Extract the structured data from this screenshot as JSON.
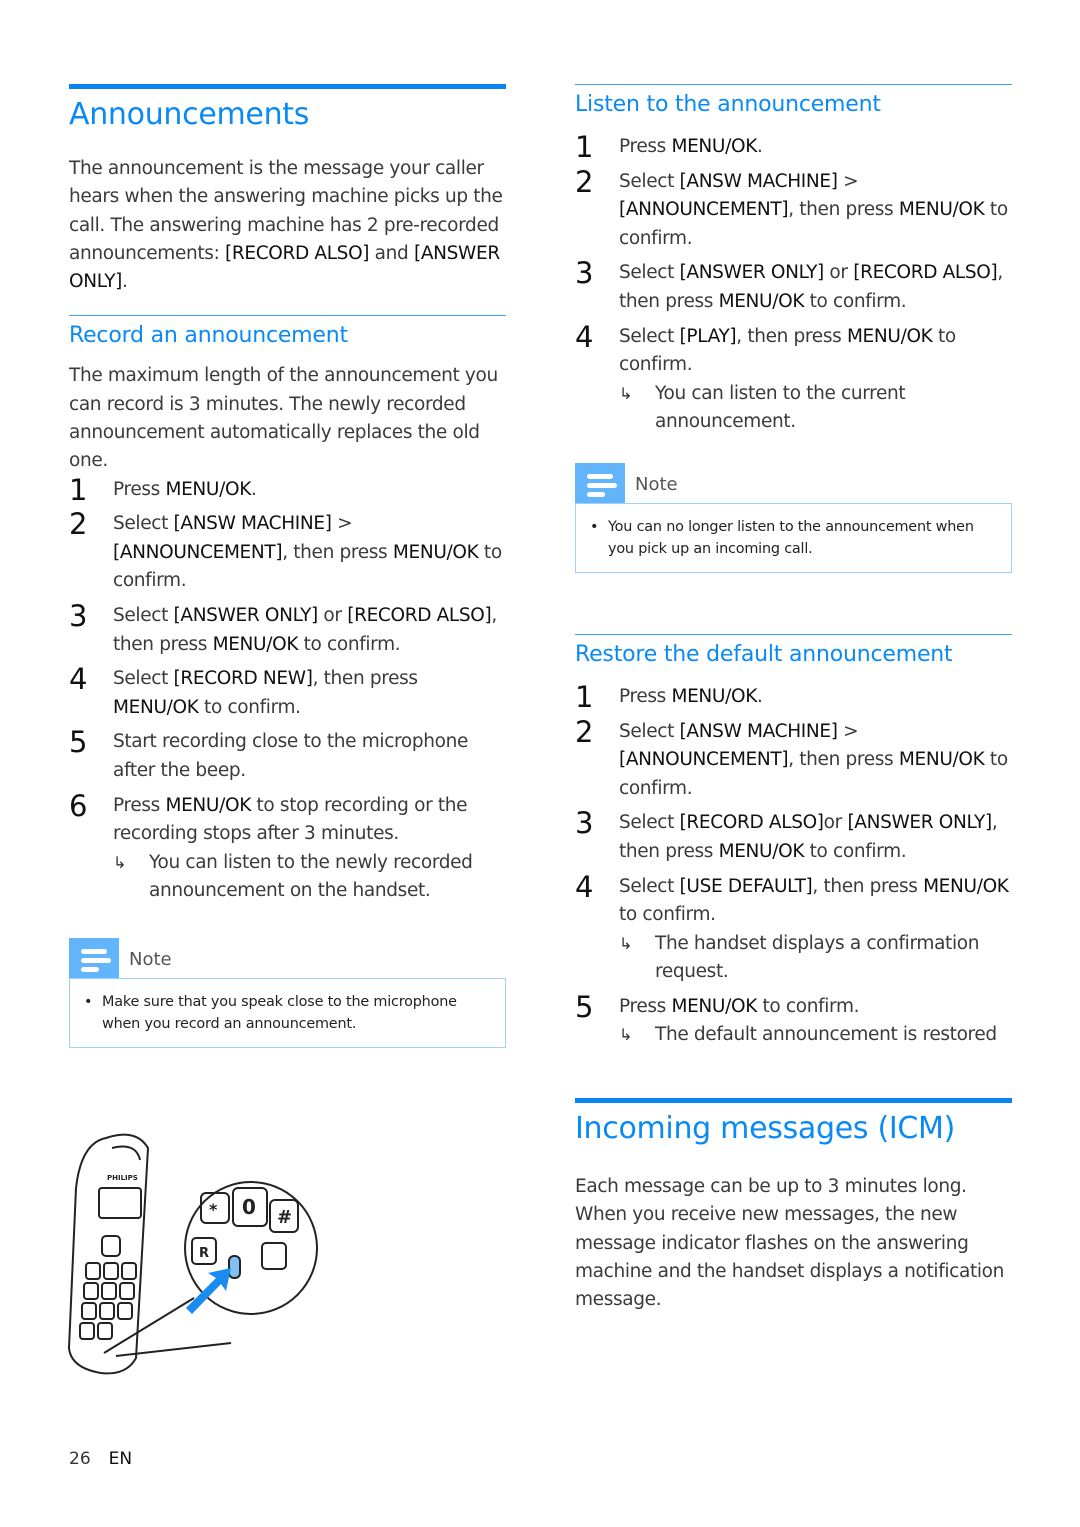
{
  "left": {
    "title": "Announcements",
    "intro": [
      {
        "t": "The announcement is the message your caller hears when the answering machine picks up the call. The answering machine has 2 pre-recorded announcements: "
      },
      {
        "k": "[RECORD ALSO]"
      },
      {
        "t": " and "
      },
      {
        "k": "[ANSWER ONLY]"
      },
      {
        "t": "."
      }
    ],
    "record": {
      "title": "Record an announcement",
      "intro": "The maximum length of the announcement you can record is 3 minutes. The newly recorded announcement automatically replaces the old one.",
      "steps": [
        {
          "num": "1",
          "parts": [
            {
              "t": "Press "
            },
            {
              "k": "MENU/OK"
            },
            {
              "t": "."
            }
          ]
        },
        {
          "num": "2",
          "parts": [
            {
              "t": "Select "
            },
            {
              "k": "[ANSW MACHINE]"
            },
            {
              "t": " > "
            },
            {
              "k": "[ANNOUNCEMENT]"
            },
            {
              "t": ", then press "
            },
            {
              "k": "MENU/OK"
            },
            {
              "t": " to confirm."
            }
          ]
        },
        {
          "num": "3",
          "parts": [
            {
              "t": "Select "
            },
            {
              "k": "[ANSWER ONLY]"
            },
            {
              "t": " or "
            },
            {
              "k": "[RECORD ALSO]"
            },
            {
              "t": ", then press "
            },
            {
              "k": "MENU/OK"
            },
            {
              "t": " to confirm."
            }
          ]
        },
        {
          "num": "4",
          "parts": [
            {
              "t": "Select "
            },
            {
              "k": "[RECORD NEW]"
            },
            {
              "t": ", then press "
            },
            {
              "k": "MENU/OK"
            },
            {
              "t": " to confirm."
            }
          ]
        },
        {
          "num": "5",
          "parts": [
            {
              "t": "Start recording close to the microphone after the beep."
            }
          ]
        },
        {
          "num": "6",
          "parts": [
            {
              "t": "Press "
            },
            {
              "k": "MENU/OK"
            },
            {
              "t": " to stop recording or the recording stops after 3 minutes."
            }
          ],
          "result": "You can listen to the newly recorded announcement on the handset."
        }
      ],
      "note": {
        "label": "Note",
        "items": [
          "Make sure that you speak close to the microphone when you record an announcement."
        ]
      }
    },
    "illustration": {
      "brand": "PHILIPS",
      "keys": [
        "*",
        "0",
        "#",
        "R",
        "0"
      ]
    }
  },
  "right": {
    "listen": {
      "title": "Listen to the announcement",
      "steps": [
        {
          "num": "1",
          "parts": [
            {
              "t": "Press "
            },
            {
              "k": "MENU/OK"
            },
            {
              "t": "."
            }
          ]
        },
        {
          "num": "2",
          "parts": [
            {
              "t": "Select "
            },
            {
              "k": "[ANSW MACHINE]"
            },
            {
              "t": " > "
            },
            {
              "k": "[ANNOUNCEMENT]"
            },
            {
              "t": ", then press "
            },
            {
              "k": "MENU/OK"
            },
            {
              "t": " to confirm."
            }
          ]
        },
        {
          "num": "3",
          "parts": [
            {
              "t": "Select "
            },
            {
              "k": "[ANSWER ONLY]"
            },
            {
              "t": " or "
            },
            {
              "k": "[RECORD ALSO]"
            },
            {
              "t": ", then press "
            },
            {
              "k": "MENU/OK"
            },
            {
              "t": " to confirm."
            }
          ]
        },
        {
          "num": "4",
          "parts": [
            {
              "t": "Select "
            },
            {
              "k": "[PLAY]"
            },
            {
              "t": ", then press "
            },
            {
              "k": "MENU/OK"
            },
            {
              "t": " to confirm."
            }
          ],
          "result": "You can listen to the current announcement."
        }
      ],
      "note": {
        "label": "Note",
        "items": [
          "You can no longer listen to the announcement when you pick up an incoming call."
        ]
      }
    },
    "restore": {
      "title": "Restore the default announcement",
      "steps": [
        {
          "num": "1",
          "parts": [
            {
              "t": "Press "
            },
            {
              "k": "MENU/OK"
            },
            {
              "t": "."
            }
          ]
        },
        {
          "num": "2",
          "parts": [
            {
              "t": "Select "
            },
            {
              "k": "[ANSW MACHINE]"
            },
            {
              "t": " > "
            },
            {
              "k": "[ANNOUNCEMENT]"
            },
            {
              "t": ", then press "
            },
            {
              "k": "MENU/OK"
            },
            {
              "t": " to confirm."
            }
          ]
        },
        {
          "num": "3",
          "parts": [
            {
              "t": "Select "
            },
            {
              "k": "[RECORD ALSO]"
            },
            {
              "t": "or "
            },
            {
              "k": "[ANSWER ONLY]"
            },
            {
              "t": ", then press "
            },
            {
              "k": "MENU/OK"
            },
            {
              "t": " to confirm."
            }
          ]
        },
        {
          "num": "4",
          "parts": [
            {
              "t": "Select "
            },
            {
              "k": "[USE DEFAULT]"
            },
            {
              "t": ", then press "
            },
            {
              "k": "MENU/OK"
            },
            {
              "t": " to confirm."
            }
          ],
          "result": "The handset displays a confirmation request."
        },
        {
          "num": "5",
          "parts": [
            {
              "t": "Press "
            },
            {
              "k": "MENU/OK"
            },
            {
              "t": " to confirm."
            }
          ],
          "result": "The default announcement is restored"
        }
      ]
    },
    "icm": {
      "title": "Incoming messages (ICM)",
      "intro": "Each message can be up to 3 minutes long. When you receive new messages, the new message indicator flashes on the answering machine and the handset displays a notification message."
    }
  },
  "footer": {
    "page": "26",
    "lang": "EN"
  },
  "colors": {
    "accent": "#0a8af5",
    "note_icon": "#62b4fb",
    "note_border": "#9fd2fb"
  }
}
